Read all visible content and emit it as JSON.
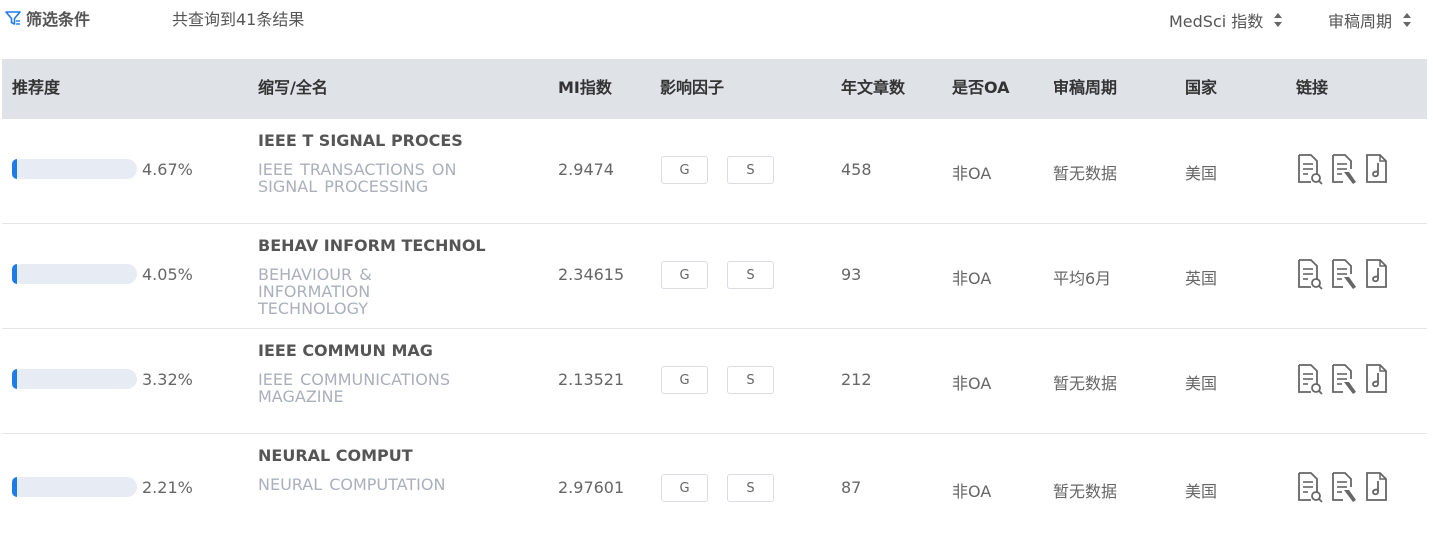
{
  "toolbar": {
    "filter_label": "筛选条件",
    "result_count": "共查询到41条结果",
    "sort_medsci_label": "MedSci 指数",
    "sort_review_label": "审稿周期",
    "filter_icon": "funnel-icon",
    "sort_icon": "sort-updown-icon"
  },
  "table": {
    "headers": {
      "recommend": "推荐度",
      "name": "缩写/全名",
      "mi": "MI指数",
      "impact": "影响因子",
      "articles": "年文章数",
      "oa": "是否OA",
      "review": "审稿周期",
      "country": "国家",
      "links": "链接"
    },
    "g_label": "G",
    "s_label": "S",
    "link_icons": [
      "search-document-icon",
      "edit-document-icon",
      "pdf-document-icon"
    ],
    "rows": [
      {
        "percent": "4.67%",
        "fraction": 0.0467,
        "abbr": "IEEE T SIGNAL PROCES",
        "full": "IEEE TRANSACTIONS ON SIGNAL PROCESSING",
        "mi": "2.9474",
        "articles": "458",
        "oa": "非OA",
        "review": "暂无数据",
        "country": "美国"
      },
      {
        "percent": "4.05%",
        "fraction": 0.0405,
        "abbr": "BEHAV INFORM TECHNOL",
        "full": "BEHAVIOUR & INFORMATION TECHNOLOGY",
        "mi": "2.34615",
        "articles": "93",
        "oa": "非OA",
        "review": "平均6月",
        "country": "英国"
      },
      {
        "percent": "3.32%",
        "fraction": 0.0332,
        "abbr": "IEEE COMMUN MAG",
        "full": "IEEE COMMUNICATIONS MAGAZINE",
        "mi": "2.13521",
        "articles": "212",
        "oa": "非OA",
        "review": "暂无数据",
        "country": "美国"
      },
      {
        "percent": "2.21%",
        "fraction": 0.0221,
        "abbr": "NEURAL COMPUT",
        "full": "NEURAL COMPUTATION",
        "mi": "2.97601",
        "articles": "87",
        "oa": "非OA",
        "review": "暂无数据",
        "country": "美国"
      }
    ]
  },
  "colors": {
    "accent": "#1e7ce8",
    "header_bg": "#dfe2e6",
    "muted_text": "#aab0bb"
  }
}
